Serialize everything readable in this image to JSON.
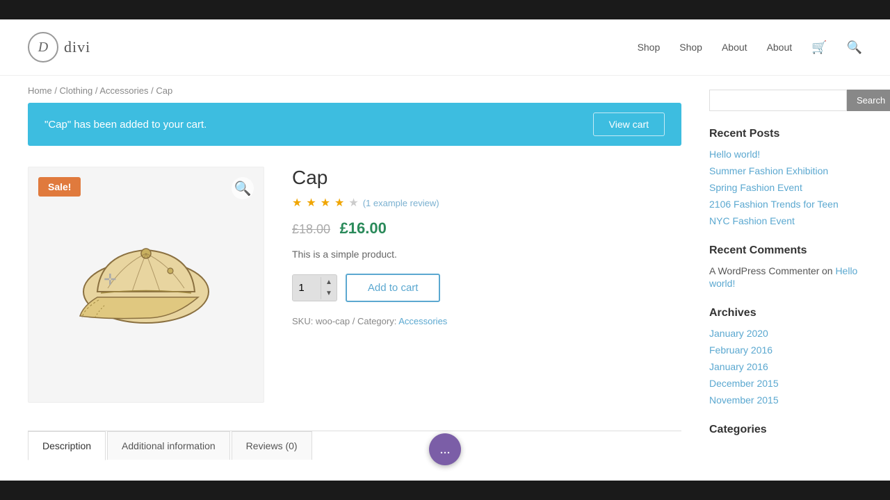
{
  "top_bar": {},
  "header": {
    "logo_letter": "D",
    "logo_name": "divi",
    "nav": [
      {
        "label": "Shop",
        "href": "#"
      },
      {
        "label": "Shop",
        "href": "#"
      },
      {
        "label": "About",
        "href": "#"
      },
      {
        "label": "About",
        "href": "#"
      }
    ]
  },
  "breadcrumb": {
    "items": [
      "Home",
      "Clothing",
      "Accessories",
      "Cap"
    ],
    "separator": "/"
  },
  "cart_notice": {
    "message": "\"Cap\" has been added to your cart.",
    "button_label": "View cart"
  },
  "product": {
    "title": "Cap",
    "sale_badge": "Sale!",
    "stars": 3.5,
    "review_text": "(1 example review)",
    "old_price": "£18.00",
    "new_price": "£16.00",
    "description": "This is a simple product.",
    "add_to_cart_label": "Add to cart",
    "quantity": "1",
    "sku": "woo-cap",
    "category": "Accessories"
  },
  "tabs": [
    {
      "label": "Description",
      "active": true
    },
    {
      "label": "Additional information",
      "active": false
    },
    {
      "label": "Reviews (0)",
      "active": false
    }
  ],
  "sidebar": {
    "search_placeholder": "",
    "search_button": "Search",
    "recent_posts_title": "Recent Posts",
    "recent_posts": [
      {
        "label": "Hello world!"
      },
      {
        "label": "Summer Fashion Exhibition"
      },
      {
        "label": "Spring Fashion Event"
      },
      {
        "label": "2106 Fashion Trends for Teen"
      },
      {
        "label": "NYC Fashion Event"
      }
    ],
    "recent_comments_title": "Recent Comments",
    "recent_comments": [
      {
        "commenter": "A WordPress Commenter",
        "on": "on",
        "post": "Hello world!"
      }
    ],
    "archives_title": "Archives",
    "archives": [
      {
        "label": "January 2020"
      },
      {
        "label": "February 2016"
      },
      {
        "label": "January 2016"
      },
      {
        "label": "December 2015"
      },
      {
        "label": "November 2015"
      }
    ],
    "categories_title": "Categories"
  },
  "float_btn": "..."
}
